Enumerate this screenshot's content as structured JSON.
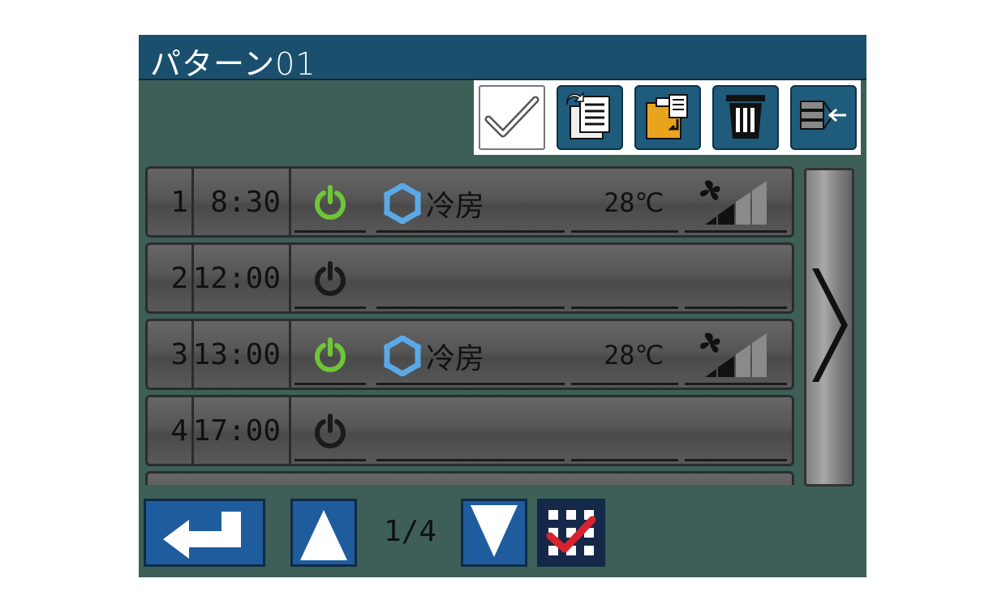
{
  "title": "パターン01",
  "toolbar": {
    "buttons": [
      {
        "icon": "check-icon"
      },
      {
        "icon": "copy-schedule-icon"
      },
      {
        "icon": "paste-clipboard-icon"
      },
      {
        "icon": "trash-icon"
      },
      {
        "icon": "import-icon"
      }
    ]
  },
  "rows": [
    {
      "num": "1",
      "time": "8:30",
      "power": "on",
      "mode": "冷房",
      "temp": "28℃",
      "fan_level": 2
    },
    {
      "num": "2",
      "time": "12:00",
      "power": "off",
      "mode": "",
      "temp": "",
      "fan_level": 0
    },
    {
      "num": "3",
      "time": "13:00",
      "power": "on",
      "mode": "冷房",
      "temp": "28℃",
      "fan_level": 2
    },
    {
      "num": "4",
      "time": "17:00",
      "power": "off",
      "mode": "",
      "temp": "",
      "fan_level": 0
    }
  ],
  "pager": {
    "text": "1/4"
  },
  "colors": {
    "power_on": "#6fc637",
    "power_off": "#1a1a1a",
    "mode_icon": "#5aa9e6",
    "accent": "#1f5c9e"
  }
}
